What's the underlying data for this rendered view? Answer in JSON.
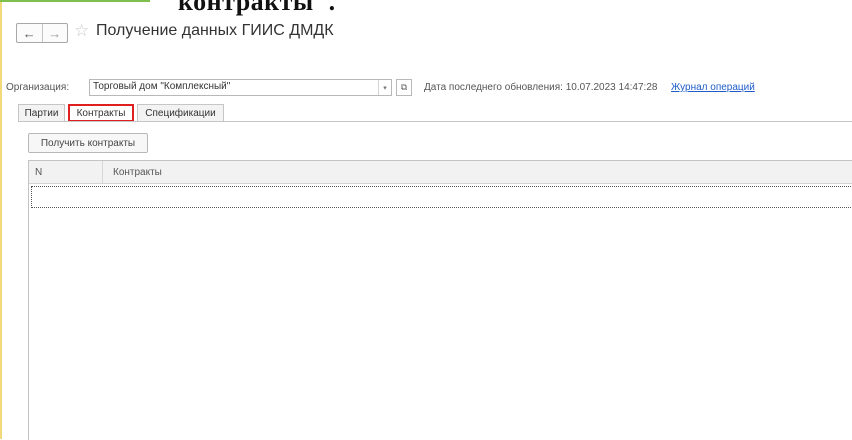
{
  "header": {
    "caption_fragment": "контракты\".",
    "title": "Получение данных ГИИС ДМДК",
    "back_glyph": "←",
    "forward_glyph": "→",
    "favorite_glyph": "☆"
  },
  "filter": {
    "organization_label": "Организация:",
    "organization_value": "Торговый дом \"Комплексный\"",
    "dropdown_glyph": "▾",
    "open_glyph": "⧉",
    "last_update_text": "Дата последнего обновления: 10.07.2023 14:47:28",
    "journal_link": "Журнал операций"
  },
  "tabs": [
    {
      "label": "Партии",
      "active": false
    },
    {
      "label": "Контракты",
      "active": true
    },
    {
      "label": "Спецификации",
      "active": false
    }
  ],
  "toolbar": {
    "get_contracts_label": "Получить контракты"
  },
  "table": {
    "columns": [
      "N",
      "Контракты"
    ],
    "rows": []
  },
  "colors": {
    "link": "#1f5cc8",
    "highlight": "#e02020",
    "accent_left": "#f2d97a",
    "accent_top": "#7fbf4d"
  },
  "icons": {
    "back": "arrow-left-icon",
    "forward": "arrow-right-icon",
    "favorite": "star-icon",
    "dropdown": "chevron-down-icon",
    "open": "open-window-icon"
  }
}
